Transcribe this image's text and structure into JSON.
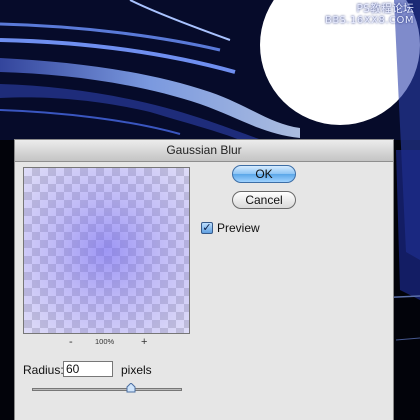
{
  "watermark": {
    "line1": "PS教程论坛",
    "line2": "BBS.16XX8.COM"
  },
  "dialog": {
    "title": "Gaussian Blur",
    "ok_label": "OK",
    "cancel_label": "Cancel",
    "preview_label": "Preview",
    "preview_checked": true,
    "zoom": {
      "minus": "-",
      "level": "100%",
      "plus": "+"
    },
    "radius": {
      "label": "Radius:",
      "value": "60",
      "unit": "pixels"
    }
  },
  "colors": {
    "ok_button": "#7fbaf0",
    "preview_tint": "#8c82f0",
    "background": "#02030a"
  }
}
